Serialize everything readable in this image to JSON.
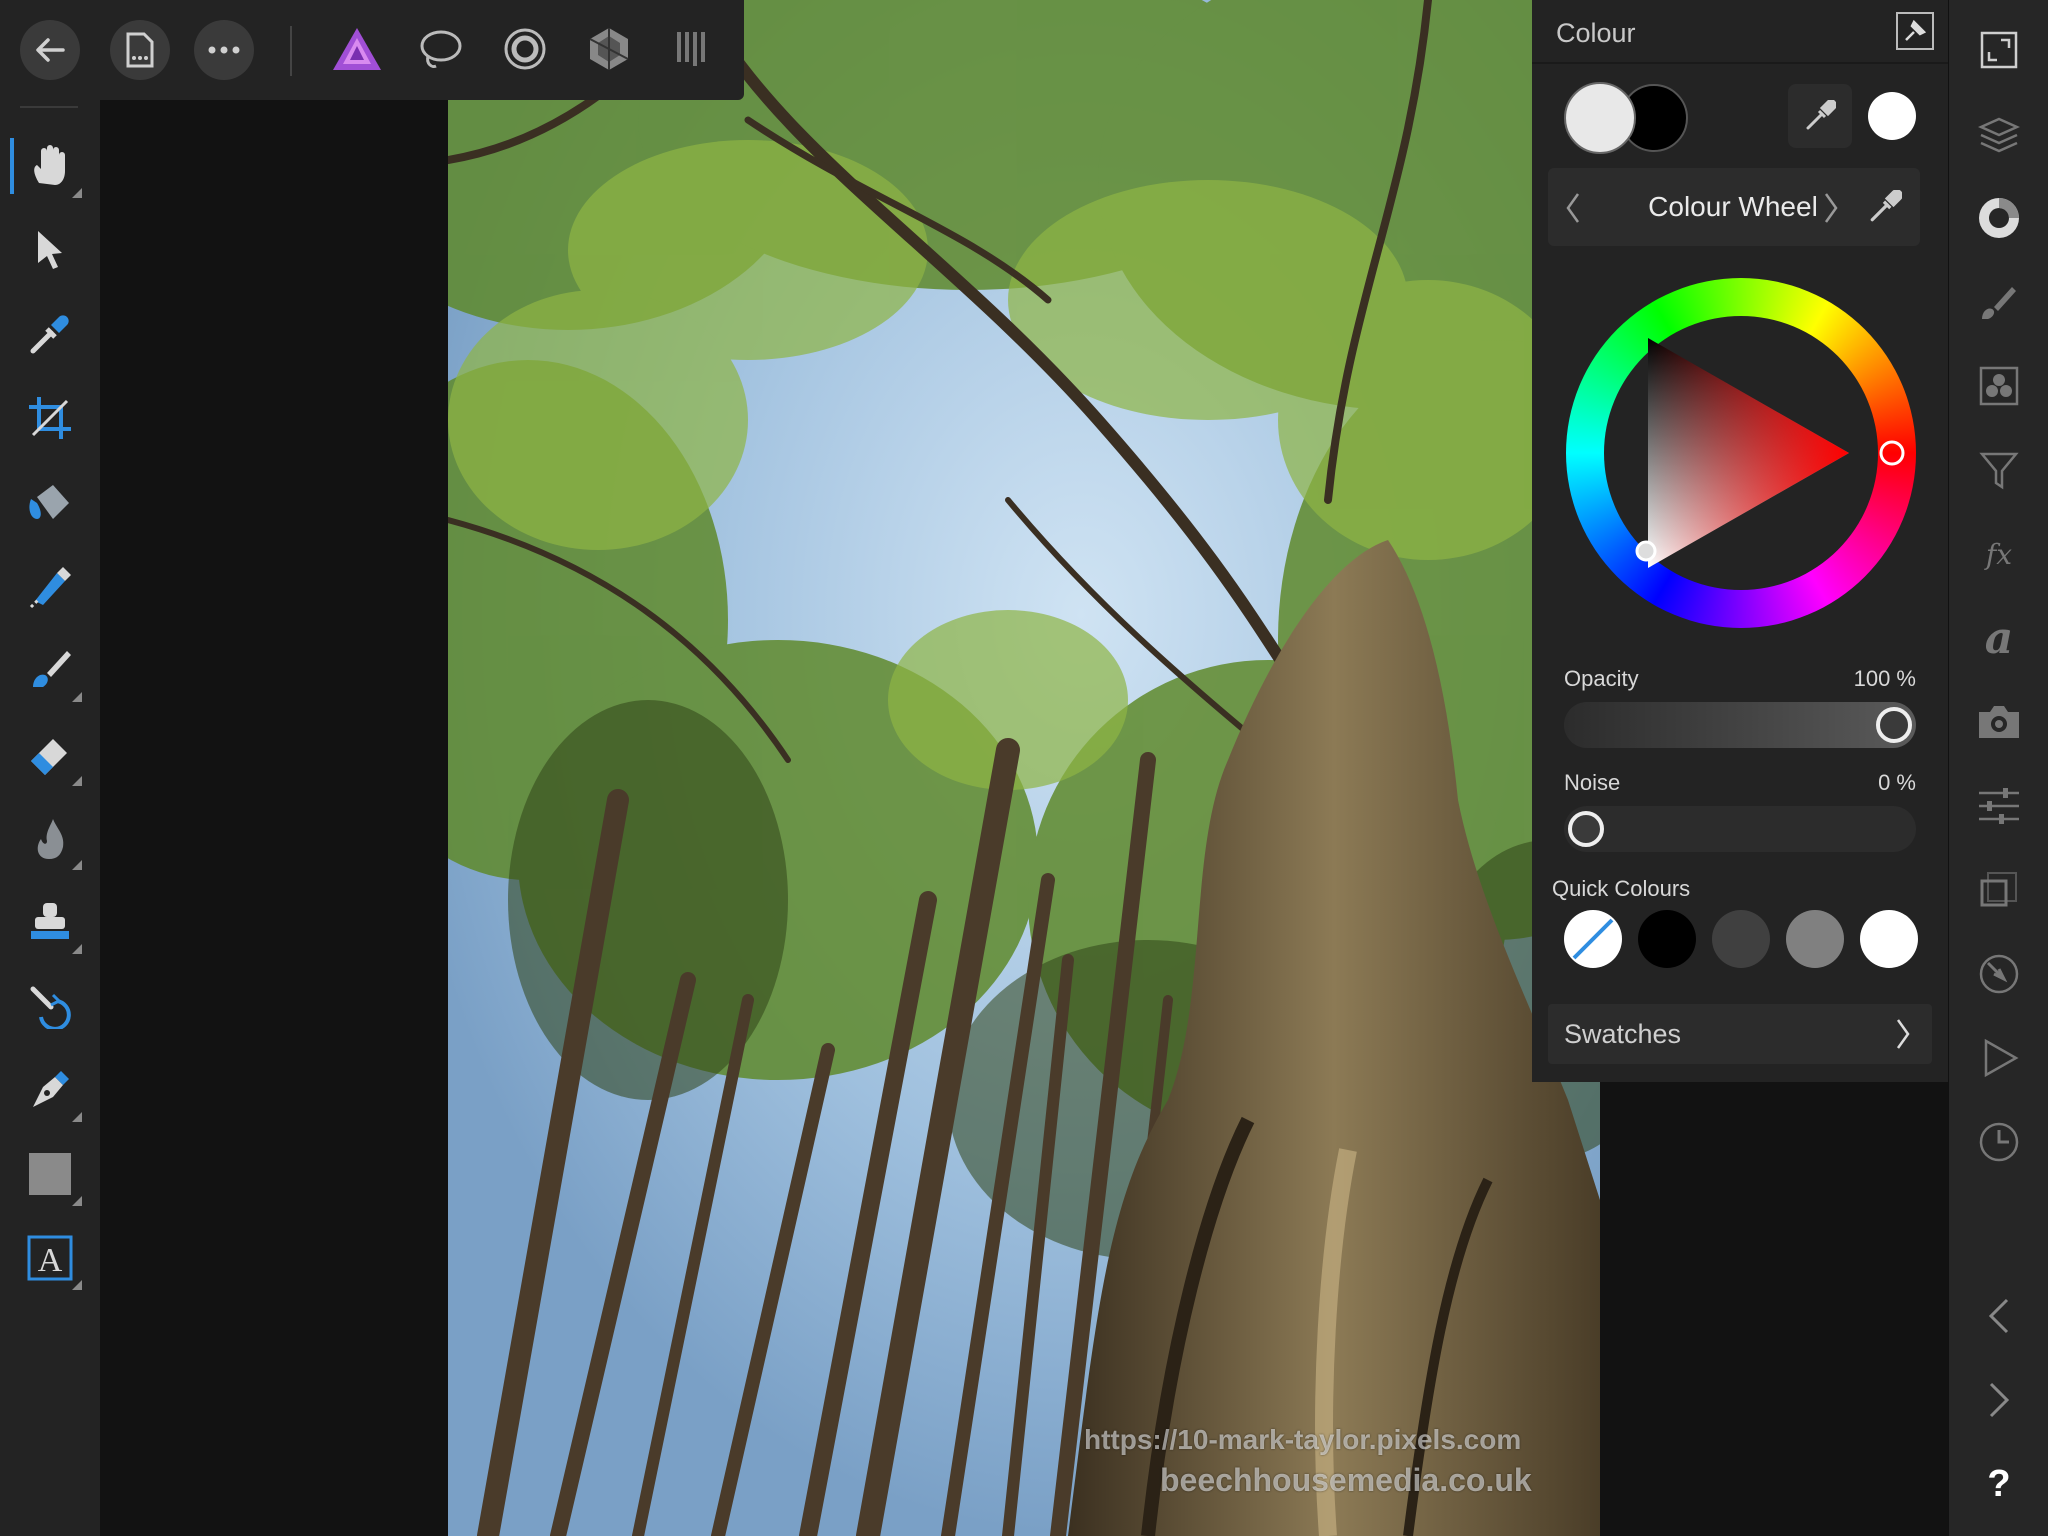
{
  "topbar": {
    "back_icon": "back-arrow-icon",
    "document_icon": "document-icon",
    "more_icon": "more-icon",
    "personas": [
      "photo-persona-icon",
      "liquify-persona-icon",
      "develop-persona-icon",
      "tone-mapping-persona-icon",
      "export-persona-icon"
    ]
  },
  "tools": [
    {
      "name": "view-tool-icon"
    },
    {
      "name": "move-tool-icon"
    },
    {
      "name": "colour-picker-tool-icon"
    },
    {
      "name": "crop-tool-icon"
    },
    {
      "name": "flood-fill-tool-icon"
    },
    {
      "name": "selection-brush-tool-icon"
    },
    {
      "name": "paint-brush-tool-icon"
    },
    {
      "name": "erase-brush-tool-icon"
    },
    {
      "name": "dodge-burn-tool-icon"
    },
    {
      "name": "clone-brush-tool-icon"
    },
    {
      "name": "undo-brush-tool-icon"
    },
    {
      "name": "pen-tool-icon"
    },
    {
      "name": "rectangle-tool-icon"
    },
    {
      "name": "text-tool-icon"
    }
  ],
  "colour_panel": {
    "title": "Colour",
    "mode_label": "Colour Wheel",
    "opacity_label": "Opacity",
    "opacity_value": "100 %",
    "opacity_level": 1.0,
    "noise_label": "Noise",
    "noise_value": "0 %",
    "noise_level": 0.0,
    "quick_colours_label": "Quick Colours",
    "quick_colours": [
      "none",
      "#000000",
      "#404040",
      "#808080",
      "#ffffff"
    ],
    "swatches_label": "Swatches",
    "primary_colour": "#e8e8e8",
    "secondary_colour": "#000000",
    "selected_hue": "#ff0000"
  },
  "watermark": {
    "line1": "https://10-mark-taylor.pixels.com",
    "line2": "beechhousemedia.co.uk"
  },
  "studio": {
    "icons": [
      "fullscreen-icon",
      "layers-icon",
      "colour-icon",
      "brushes-icon",
      "channels-icon",
      "filter-icon",
      "effects-icon",
      "text-styles-icon",
      "camera-icon",
      "adjustments-icon",
      "transform-icon",
      "navigator-icon",
      "macro-icon",
      "history-icon"
    ],
    "bottom_icons": [
      "collapse-left-icon",
      "collapse-right-icon"
    ],
    "help_label": "?"
  }
}
